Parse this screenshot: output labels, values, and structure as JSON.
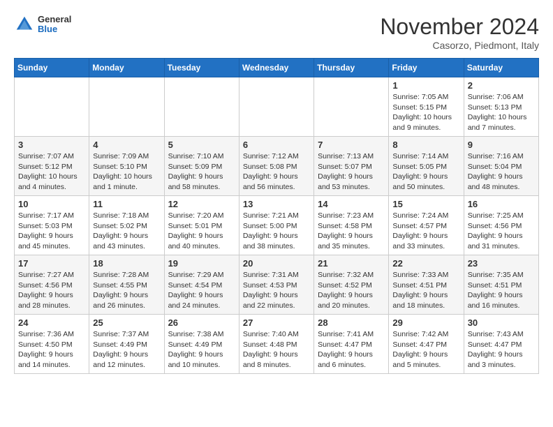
{
  "header": {
    "logo": {
      "general": "General",
      "blue": "Blue"
    },
    "title": "November 2024",
    "location": "Casorzo, Piedmont, Italy"
  },
  "weekdays": [
    "Sunday",
    "Monday",
    "Tuesday",
    "Wednesday",
    "Thursday",
    "Friday",
    "Saturday"
  ],
  "weeks": [
    [
      {
        "day": "",
        "info": ""
      },
      {
        "day": "",
        "info": ""
      },
      {
        "day": "",
        "info": ""
      },
      {
        "day": "",
        "info": ""
      },
      {
        "day": "",
        "info": ""
      },
      {
        "day": "1",
        "info": "Sunrise: 7:05 AM\nSunset: 5:15 PM\nDaylight: 10 hours and 9 minutes."
      },
      {
        "day": "2",
        "info": "Sunrise: 7:06 AM\nSunset: 5:13 PM\nDaylight: 10 hours and 7 minutes."
      }
    ],
    [
      {
        "day": "3",
        "info": "Sunrise: 7:07 AM\nSunset: 5:12 PM\nDaylight: 10 hours and 4 minutes."
      },
      {
        "day": "4",
        "info": "Sunrise: 7:09 AM\nSunset: 5:10 PM\nDaylight: 10 hours and 1 minute."
      },
      {
        "day": "5",
        "info": "Sunrise: 7:10 AM\nSunset: 5:09 PM\nDaylight: 9 hours and 58 minutes."
      },
      {
        "day": "6",
        "info": "Sunrise: 7:12 AM\nSunset: 5:08 PM\nDaylight: 9 hours and 56 minutes."
      },
      {
        "day": "7",
        "info": "Sunrise: 7:13 AM\nSunset: 5:07 PM\nDaylight: 9 hours and 53 minutes."
      },
      {
        "day": "8",
        "info": "Sunrise: 7:14 AM\nSunset: 5:05 PM\nDaylight: 9 hours and 50 minutes."
      },
      {
        "day": "9",
        "info": "Sunrise: 7:16 AM\nSunset: 5:04 PM\nDaylight: 9 hours and 48 minutes."
      }
    ],
    [
      {
        "day": "10",
        "info": "Sunrise: 7:17 AM\nSunset: 5:03 PM\nDaylight: 9 hours and 45 minutes."
      },
      {
        "day": "11",
        "info": "Sunrise: 7:18 AM\nSunset: 5:02 PM\nDaylight: 9 hours and 43 minutes."
      },
      {
        "day": "12",
        "info": "Sunrise: 7:20 AM\nSunset: 5:01 PM\nDaylight: 9 hours and 40 minutes."
      },
      {
        "day": "13",
        "info": "Sunrise: 7:21 AM\nSunset: 5:00 PM\nDaylight: 9 hours and 38 minutes."
      },
      {
        "day": "14",
        "info": "Sunrise: 7:23 AM\nSunset: 4:58 PM\nDaylight: 9 hours and 35 minutes."
      },
      {
        "day": "15",
        "info": "Sunrise: 7:24 AM\nSunset: 4:57 PM\nDaylight: 9 hours and 33 minutes."
      },
      {
        "day": "16",
        "info": "Sunrise: 7:25 AM\nSunset: 4:56 PM\nDaylight: 9 hours and 31 minutes."
      }
    ],
    [
      {
        "day": "17",
        "info": "Sunrise: 7:27 AM\nSunset: 4:56 PM\nDaylight: 9 hours and 28 minutes."
      },
      {
        "day": "18",
        "info": "Sunrise: 7:28 AM\nSunset: 4:55 PM\nDaylight: 9 hours and 26 minutes."
      },
      {
        "day": "19",
        "info": "Sunrise: 7:29 AM\nSunset: 4:54 PM\nDaylight: 9 hours and 24 minutes."
      },
      {
        "day": "20",
        "info": "Sunrise: 7:31 AM\nSunset: 4:53 PM\nDaylight: 9 hours and 22 minutes."
      },
      {
        "day": "21",
        "info": "Sunrise: 7:32 AM\nSunset: 4:52 PM\nDaylight: 9 hours and 20 minutes."
      },
      {
        "day": "22",
        "info": "Sunrise: 7:33 AM\nSunset: 4:51 PM\nDaylight: 9 hours and 18 minutes."
      },
      {
        "day": "23",
        "info": "Sunrise: 7:35 AM\nSunset: 4:51 PM\nDaylight: 9 hours and 16 minutes."
      }
    ],
    [
      {
        "day": "24",
        "info": "Sunrise: 7:36 AM\nSunset: 4:50 PM\nDaylight: 9 hours and 14 minutes."
      },
      {
        "day": "25",
        "info": "Sunrise: 7:37 AM\nSunset: 4:49 PM\nDaylight: 9 hours and 12 minutes."
      },
      {
        "day": "26",
        "info": "Sunrise: 7:38 AM\nSunset: 4:49 PM\nDaylight: 9 hours and 10 minutes."
      },
      {
        "day": "27",
        "info": "Sunrise: 7:40 AM\nSunset: 4:48 PM\nDaylight: 9 hours and 8 minutes."
      },
      {
        "day": "28",
        "info": "Sunrise: 7:41 AM\nSunset: 4:47 PM\nDaylight: 9 hours and 6 minutes."
      },
      {
        "day": "29",
        "info": "Sunrise: 7:42 AM\nSunset: 4:47 PM\nDaylight: 9 hours and 5 minutes."
      },
      {
        "day": "30",
        "info": "Sunrise: 7:43 AM\nSunset: 4:47 PM\nDaylight: 9 hours and 3 minutes."
      }
    ]
  ]
}
